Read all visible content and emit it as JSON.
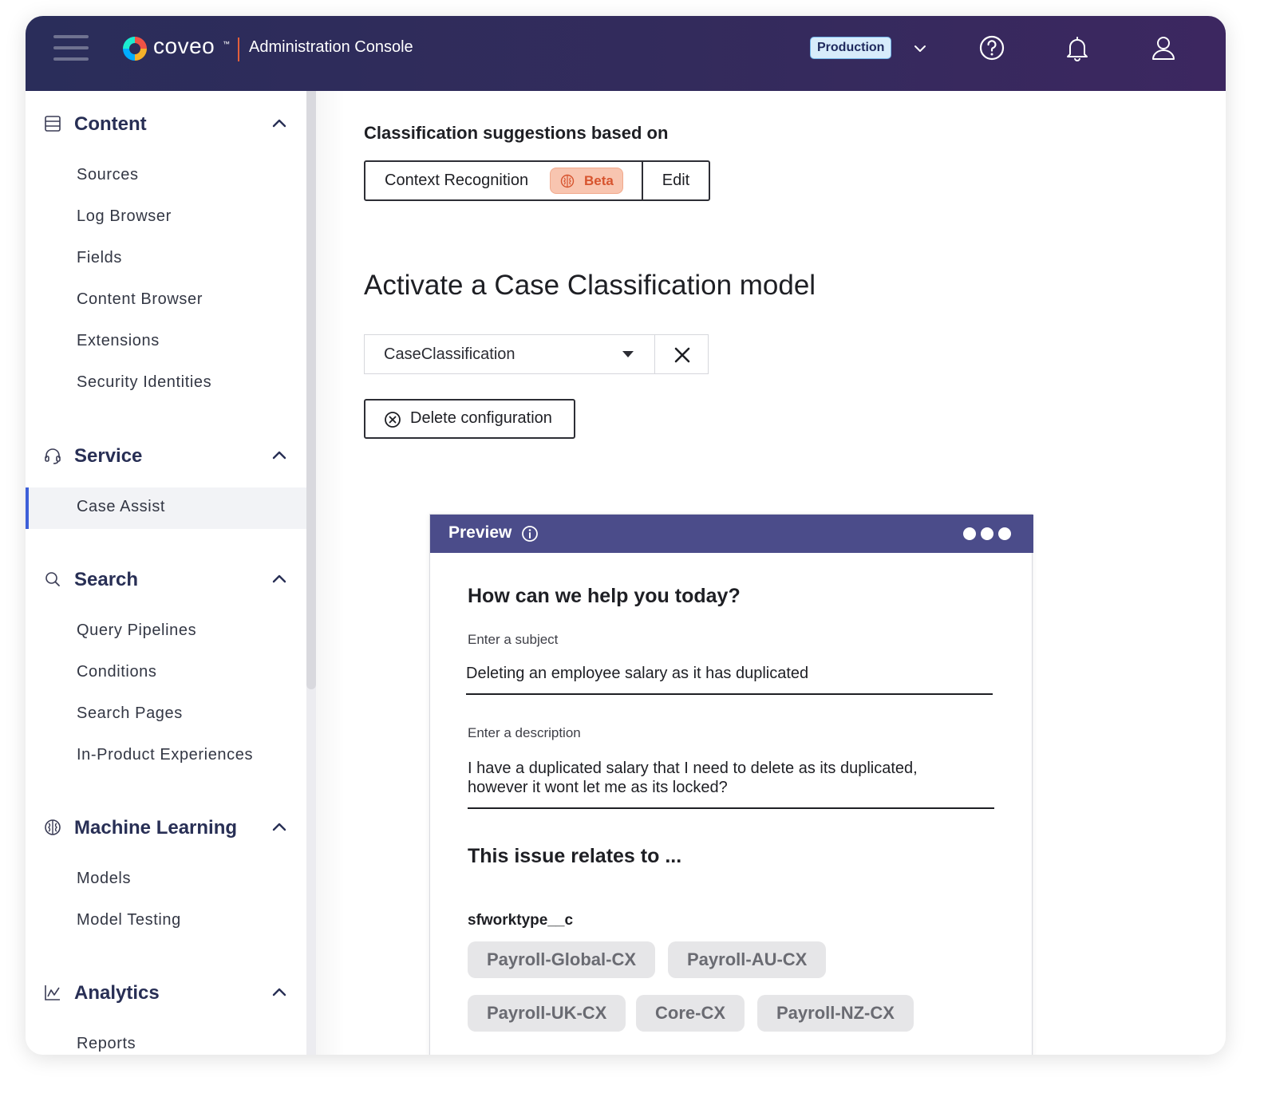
{
  "topbar": {
    "brand": "coveo",
    "brand_tm": "™",
    "console_title": "Administration Console",
    "environment": "Production",
    "icons": [
      "hamburger-icon",
      "coveo-logo",
      "chevron-down-icon",
      "help-icon",
      "bell-icon",
      "user-icon"
    ],
    "colors": {
      "bar": "#2a2d5a",
      "badge_bg": "#d7ecfb",
      "logo_divider": "#e35f3b"
    }
  },
  "sidebar": {
    "sections": [
      {
        "title": "Content",
        "icon": "database-icon",
        "items": [
          "Sources",
          "Log Browser",
          "Fields",
          "Content Browser",
          "Extensions",
          "Security Identities"
        ]
      },
      {
        "title": "Service",
        "icon": "headset-icon",
        "items": [
          "Case Assist"
        ],
        "active": "Case Assist"
      },
      {
        "title": "Search",
        "icon": "search-icon",
        "items": [
          "Query Pipelines",
          "Conditions",
          "Search Pages",
          "In-Product Experiences"
        ]
      },
      {
        "title": "Machine Learning",
        "icon": "brain-icon",
        "items": [
          "Models",
          "Model Testing"
        ]
      },
      {
        "title": "Analytics",
        "icon": "chart-line-icon",
        "items": [
          "Reports"
        ]
      }
    ],
    "colors": {
      "active_indicator": "#3d5fd8",
      "active_bg": "#f2f3f6"
    }
  },
  "main": {
    "classification_heading": "Classification suggestions based on",
    "context_label": "Context Recognition",
    "beta_label": "Beta",
    "edit_label": "Edit",
    "activate_heading": "Activate a Case Classification model",
    "model_selected": "CaseClassification",
    "delete_label": "Delete configuration",
    "colors": {
      "beta_bg": "#f8c5b0",
      "beta_text": "#d7542e"
    }
  },
  "preview": {
    "title": "Preview",
    "question": "How can we help you today?",
    "subject_label": "Enter a subject",
    "subject_value": "Deleting an employee salary as it has duplicated",
    "description_label": "Enter a description",
    "description_value": "I have a duplicated salary that I need to delete as its duplicated, however it wont let me as its locked?",
    "relates_heading": "This issue relates to ...",
    "field_name": "sfworktype__c",
    "chips": [
      "Payroll-Global-CX",
      "Payroll-AU-CX",
      "Payroll-UK-CX",
      "Core-CX",
      "Payroll-NZ-CX"
    ],
    "colors": {
      "header_bg": "#4b4c8a",
      "chip_bg": "#e6e6e8"
    }
  }
}
